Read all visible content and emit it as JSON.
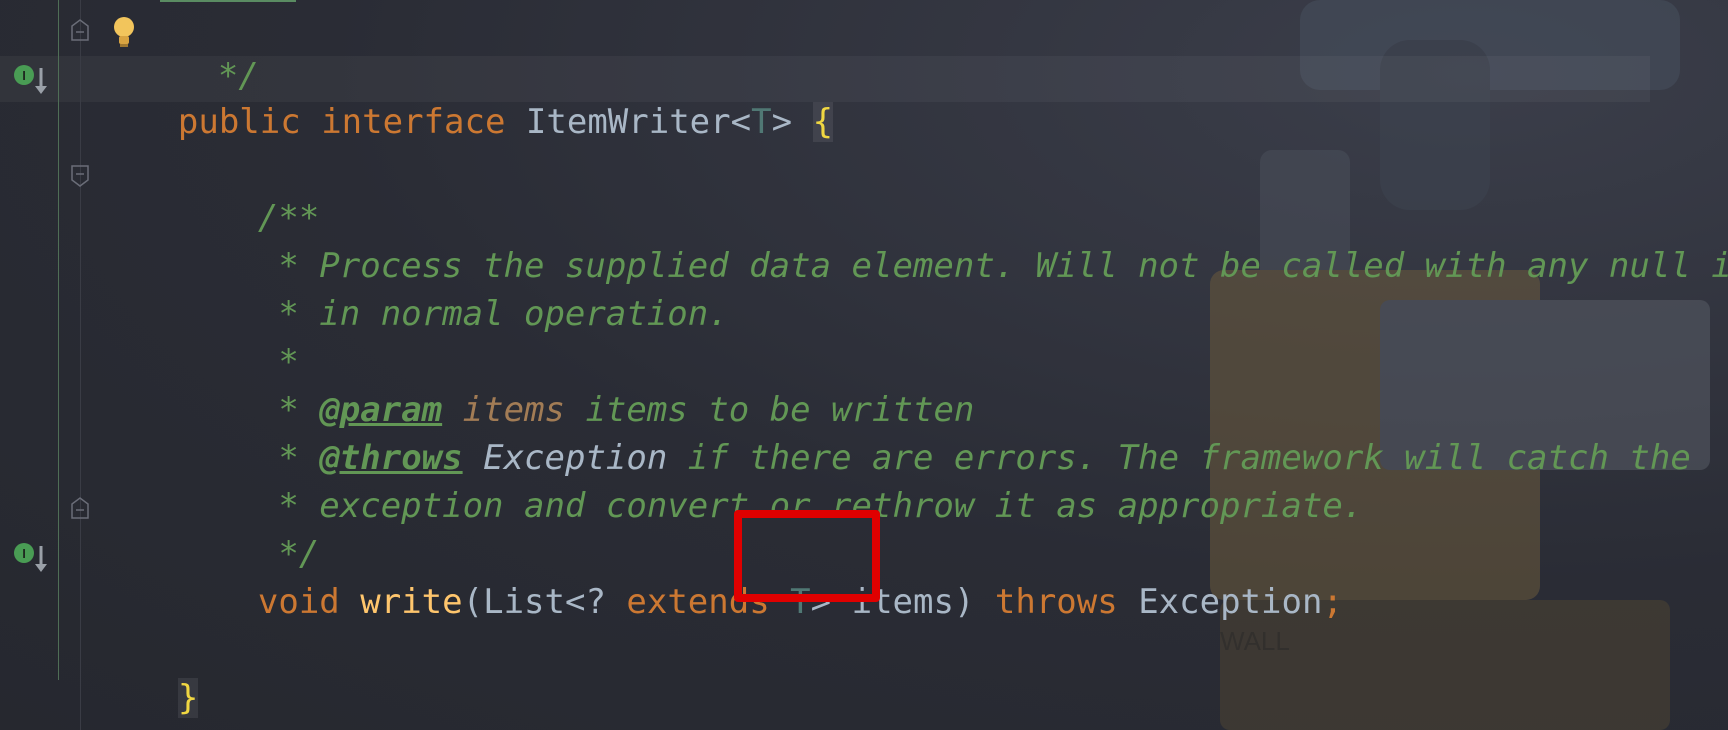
{
  "editor": {
    "lines": {
      "l0": {
        "text": "*/"
      },
      "l1": {
        "kw1": "public",
        "kw2": "interface",
        "name": "ItemWriter",
        "lt": "<",
        "tp": "T",
        "gt": ">",
        "brace": "{"
      },
      "l3": {
        "text": "/**"
      },
      "l4": {
        "text": " * Process the supplied data element. Will not be called with any null items"
      },
      "l5": {
        "text": " * in normal operation."
      },
      "l6": {
        "text": " *"
      },
      "l7": {
        "star": " * ",
        "tag": "@param",
        "param": "items",
        "rest": " items to be written"
      },
      "l8": {
        "star": " * ",
        "tag": "@throws",
        "ref": "Exception",
        "rest": " if there are errors. The framework will catch the"
      },
      "l9": {
        "text": " * exception and convert or rethrow it as appropriate."
      },
      "l10": {
        "text": " */"
      },
      "l11": {
        "kw_void": "void",
        "fn": "write",
        "p1": "(List<? ",
        "kw_ext": "extends",
        "tp": "T",
        "p2": "> items) ",
        "kw_throws": "throws",
        "ex": "Exception",
        "semi": ";"
      },
      "l13": {
        "brace": "}"
      }
    }
  },
  "annotations": {
    "highlight_color": "#e00000",
    "implemented_icon_label": "I"
  }
}
